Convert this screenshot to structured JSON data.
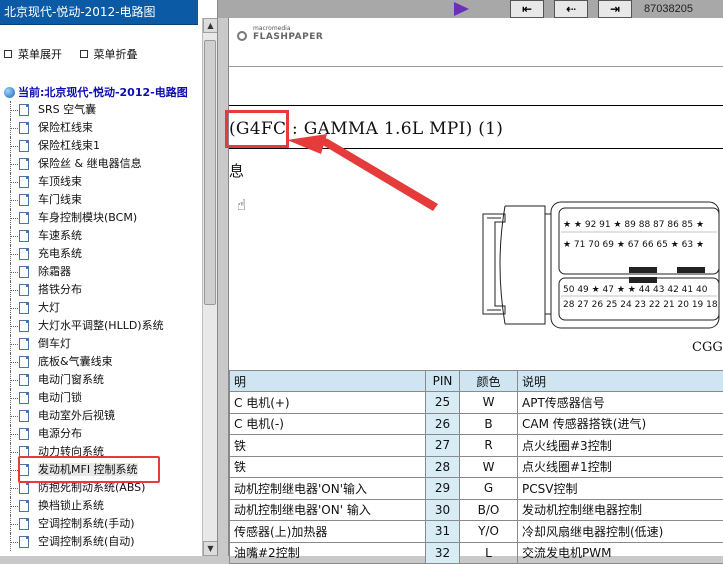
{
  "sidebar": {
    "title": "北京现代-悦动-2012-电路图",
    "expand_label": "菜单展开",
    "collapse_label": "菜单折叠",
    "root_label": "当前:北京现代-悦动-2012-电路图",
    "items": [
      {
        "label": "SRS 空气囊"
      },
      {
        "label": "保险杠线束"
      },
      {
        "label": "保险杠线束1"
      },
      {
        "label": "保险丝 & 继电器信息"
      },
      {
        "label": "车顶线束"
      },
      {
        "label": "车门线束"
      },
      {
        "label": "车身控制模块(BCM)"
      },
      {
        "label": "车速系统"
      },
      {
        "label": "充电系统"
      },
      {
        "label": "除霜器"
      },
      {
        "label": "搭铁分布"
      },
      {
        "label": "大灯"
      },
      {
        "label": "大灯水平调整(HLLD)系统"
      },
      {
        "label": "倒车灯"
      },
      {
        "label": "底板&气囊线束"
      },
      {
        "label": "电动门窗系统"
      },
      {
        "label": "电动门锁"
      },
      {
        "label": "电动室外后视镜"
      },
      {
        "label": "电源分布"
      },
      {
        "label": "动力转向系统"
      },
      {
        "label": "发动机MFI 控制系统"
      },
      {
        "label": "防抱死制动系统(ABS)"
      },
      {
        "label": "换档锁止系统"
      },
      {
        "label": "空调控制系统(手动)"
      },
      {
        "label": "空调控制系统(自动)"
      }
    ]
  },
  "topbar": {
    "info": "87038205"
  },
  "document": {
    "logo_small": "macromedia",
    "logo_big": "FLASHPAPER",
    "engine_title": "(G4FC : GAMMA 1.6L MPI) (1)",
    "partial_char": "息",
    "cgg_label": "CGG-",
    "connector_rows": [
      "★ ★ 92 91 ★ 89 88 87 86 85 ★",
      "★ 71 70 69 ★ 67 66 65 ★ 63 ★",
      "50 49 ★ 47 ★ ★ 44 43 42 41 40",
      "28 27 26 25 24 23 22 21 20 19 18"
    ],
    "table": {
      "headers": [
        "明",
        "PIN",
        "颜色",
        "说明"
      ],
      "rows": [
        [
          "C 电机(+)",
          "25",
          "W",
          "APT传感器信号"
        ],
        [
          "C 电机(-)",
          "26",
          "B",
          "CAM 传感器搭铁(进气)"
        ],
        [
          "铁",
          "27",
          "R",
          "点火线圈#3控制"
        ],
        [
          "铁",
          "28",
          "W",
          "点火线圈#1控制"
        ],
        [
          "动机控制继电器'ON'输入",
          "29",
          "G",
          "PCSV控制"
        ],
        [
          "动机控制继电器'ON' 输入",
          "30",
          "B/O",
          "发动机控制继电器控制"
        ],
        [
          "传感器(上)加热器",
          "31",
          "Y/O",
          "冷却风扇继电器控制(低速)"
        ],
        [
          "油嘴#2控制",
          "32",
          "L",
          "交流发电机PWM"
        ]
      ]
    }
  },
  "colors": {
    "sidebar_header": "#0b5aa5",
    "annotation_red": "#e53b3b",
    "table_header": "#cfe6f2",
    "play_button": "#6b2fb8"
  }
}
